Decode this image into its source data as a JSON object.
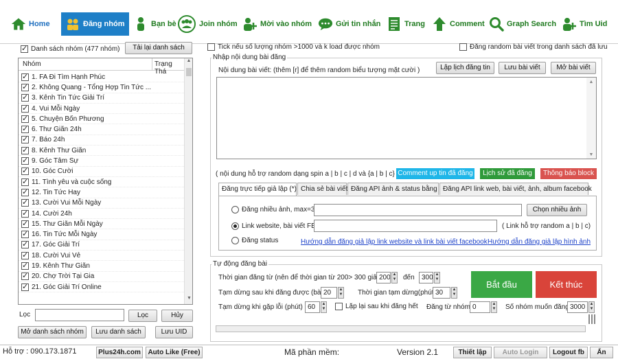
{
  "nav": {
    "items": [
      {
        "label": "Home",
        "icon": "home-icon"
      },
      {
        "label": "Đăng nhóm",
        "icon": "group-post-icon"
      },
      {
        "label": "Bạn bè",
        "icon": "friend-icon"
      },
      {
        "label": "Join nhóm",
        "icon": "join-group-icon"
      },
      {
        "label": "Mời vào nhóm",
        "icon": "invite-icon"
      },
      {
        "label": "Gửi tin nhắn",
        "icon": "message-icon"
      },
      {
        "label": "Trang",
        "icon": "page-icon"
      },
      {
        "label": "Comment",
        "icon": "comment-icon"
      },
      {
        "label": "Graph Search",
        "icon": "search-icon"
      },
      {
        "label": "Tìm Uid",
        "icon": "find-uid-icon"
      }
    ]
  },
  "left": {
    "list_header_label": "Danh sách nhóm (477 nhóm)",
    "reload_button": "Tải lại danh sách",
    "col_group": "Nhóm",
    "col_status": "Trạng Thá",
    "groups": [
      "1. FA Đi Tìm Hạnh Phúc",
      "2. Không Quang - Tổng Hợp Tin Tức ...",
      "3. Kênh Tin Tức Giải Trí",
      "4. Vui Mỗi Ngày",
      "5. Chuyện Bốn Phương",
      "6. Thư Giãn 24h",
      "7. Báo 24h",
      "8. Kênh Thư Giãn",
      "9. Góc Tâm Sự",
      "10. Góc Cười",
      "11. Tình yêu và cuộc sống",
      "12. Tin Tức Hay",
      "13. Cười Vui Mỗi Ngày",
      "14. Cười 24h",
      "15. Thư Giãn Mỗi Ngày",
      "16. Tin Tức Mỗi Ngày",
      "17. Góc Giải Trí",
      "18. Cười Vui Vẻ",
      "19. Kênh Thư Giãn",
      "20. Chợ Trời Tại Gia",
      "21. Góc Giải Trí Online"
    ],
    "filter_label": "Lọc",
    "filter_button": "Lọc",
    "cancel_button": "Hủy",
    "open_list_button": "Mở danh sách nhóm",
    "save_list_button": "Lưu danh sách",
    "save_uid_button": "Lưu UID"
  },
  "top_options": {
    "tick_label": "Tick nếu số lượng nhóm >1000 và k load được nhóm",
    "random_label": "Đăng random bài viết trong danh sách đã lưu"
  },
  "content": {
    "group_title": "Nhập nội dung bài đăng",
    "content_label": "Nội dung bài viết: (thêm [r] để thêm random biểu tượng mặt cười )",
    "schedule_button": "Lập lịch đăng tin",
    "save_post_button": "Lưu bài viết",
    "open_post_button": "Mở bài viết",
    "textarea_value": "",
    "spin_hint": "( nội dung hỗ trợ random dạng spin a | b | c | d và {a | b | c} )",
    "comment_up_button": "Comment up tin đã đăng",
    "history_button": "Lịch sử đã đăng",
    "block_button": "Thông báo block"
  },
  "tabs": [
    "Đăng trực tiếp giả lập (*)",
    "Chia sẻ bài viết",
    "Đăng API ảnh & status bằng",
    "Đăng API link web, bài viết, ảnh, album facebook"
  ],
  "post_modes": {
    "multi_image_label": "Đăng nhiều ảnh, max=3",
    "multi_image_value": "",
    "choose_images_button": "Chọn nhiều ảnh",
    "link_label": "Link website, bài viết FB",
    "link_value": "",
    "link_hint": "( Link hỗ trợ random  a | b | c)",
    "status_label": "Đăng status",
    "guide_link_web": "Hướng dẫn đăng giả lập link website và link bài viết facebook",
    "guide_image": "Hướng dẫn đăng giả lập hình ảnh"
  },
  "auto": {
    "group_title": "Tự động đăng bài",
    "interval_label": "Thời gian đăng từ (nên để thời gian từ 200> 300 giây)",
    "interval_from": "200",
    "to_label": "đến",
    "interval_to": "300",
    "pause_after_label": "Tạm dừng sau khi đăng được (bài)",
    "pause_after_value": "20",
    "pause_time_label": "Thời gian tạm dừng(phút)",
    "pause_time_value": "30",
    "pause_error_label": "Tạm dừng khi gặp lỗi (phút)",
    "pause_error_value": "60",
    "repeat_label": "Lặp lại sau khi đăng hết",
    "from_group_label": "Đăng từ nhóm",
    "from_group_value": "0",
    "count_label": "Số nhóm muốn đăng",
    "count_value": "3000",
    "start_button": "Bắt đầu",
    "stop_button": "Kết thúc"
  },
  "status": {
    "support": "Hỗ trợ : 090.173.1871",
    "site": "Plus24h.com",
    "autolike": "Auto Like (Free)",
    "code_label": "Mã phần mềm:",
    "version": "Version 2.1",
    "settings": "Thiết lập",
    "auto_login": "Auto Login",
    "logout": "Logout fb",
    "hide": "Ẩn"
  },
  "colors": {
    "nav_active": "#1e7fc7",
    "nav_text": "#1f7a1f",
    "start_green": "#3aa845",
    "stop_red": "#d9443a",
    "comment_up": "#1fb6e8",
    "history": "#2f9a3a",
    "block": "#d9534f"
  }
}
